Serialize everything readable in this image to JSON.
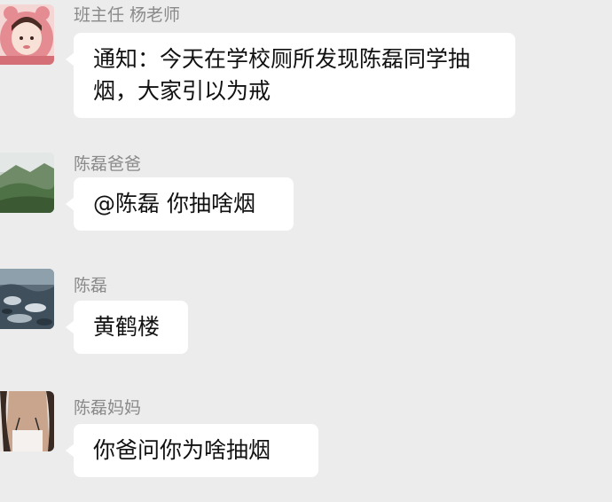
{
  "messages": [
    {
      "sender": "班主任 杨老师",
      "avatar_icon": "girl-pink-hood-avatar",
      "text": "通知：今天在学校厕所发现陈磊同学抽烟，大家引以为戒"
    },
    {
      "sender": "陈磊爸爸",
      "avatar_icon": "mountain-landscape-avatar",
      "text": "@陈磊 你抽啥烟"
    },
    {
      "sender": "陈磊",
      "avatar_icon": "rocky-shore-avatar",
      "text": "黄鹤楼"
    },
    {
      "sender": "陈磊妈妈",
      "avatar_icon": "woman-portrait-avatar",
      "text": "你爸问你为啥抽烟"
    }
  ]
}
